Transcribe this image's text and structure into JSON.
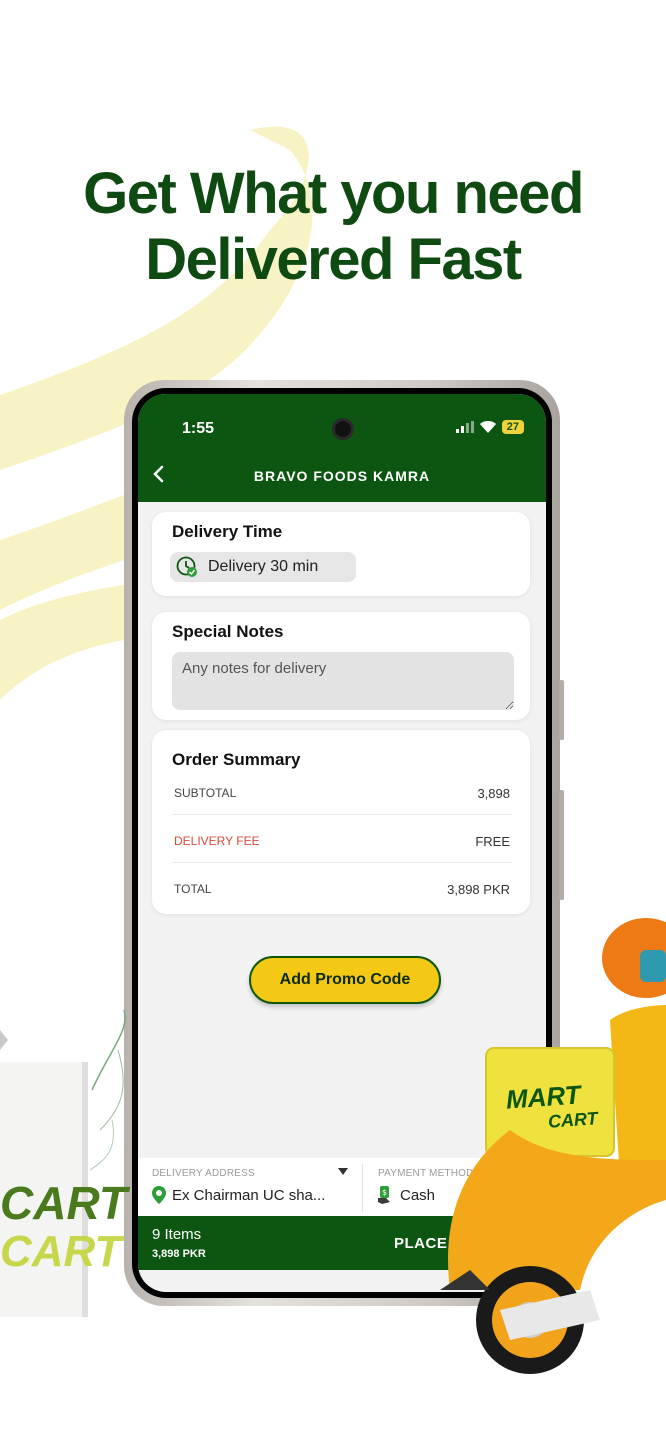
{
  "headline": {
    "line1": "Get What you need",
    "line2": "Delivered Fast"
  },
  "status_bar": {
    "time": "1:55",
    "battery": "27"
  },
  "header": {
    "title": "BRAVO FOODS KAMRA"
  },
  "delivery_time": {
    "title": "Delivery Time",
    "chip_label": "Delivery 30 min"
  },
  "special_notes": {
    "title": "Special Notes",
    "placeholder": "Any notes for delivery"
  },
  "order_summary": {
    "title": "Order Summary",
    "subtotal_label": "SUBTOTAL",
    "subtotal_value": "3,898",
    "delivery_fee_label": "DELIVERY FEE",
    "delivery_fee_value": "FREE",
    "total_label": "TOTAL",
    "total_value": "3,898 PKR"
  },
  "promo_button": "Add Promo Code",
  "delivery_address": {
    "label": "DELIVERY ADDRESS",
    "value": "Ex Chairman UC sha..."
  },
  "payment_method": {
    "label": "PAYMENT METHOD",
    "value": "Cash"
  },
  "order_bar": {
    "items": "9 Items",
    "total": "3,898 PKR",
    "place_label": "PLACE ORDER"
  },
  "brand": {
    "line1": "MART",
    "line2": "CART"
  },
  "colors": {
    "primary_green": "#0c5611",
    "accent_yellow": "#f3c915",
    "fee_red": "#d94a3b",
    "swoosh_yellow": "#f7f3c4"
  }
}
